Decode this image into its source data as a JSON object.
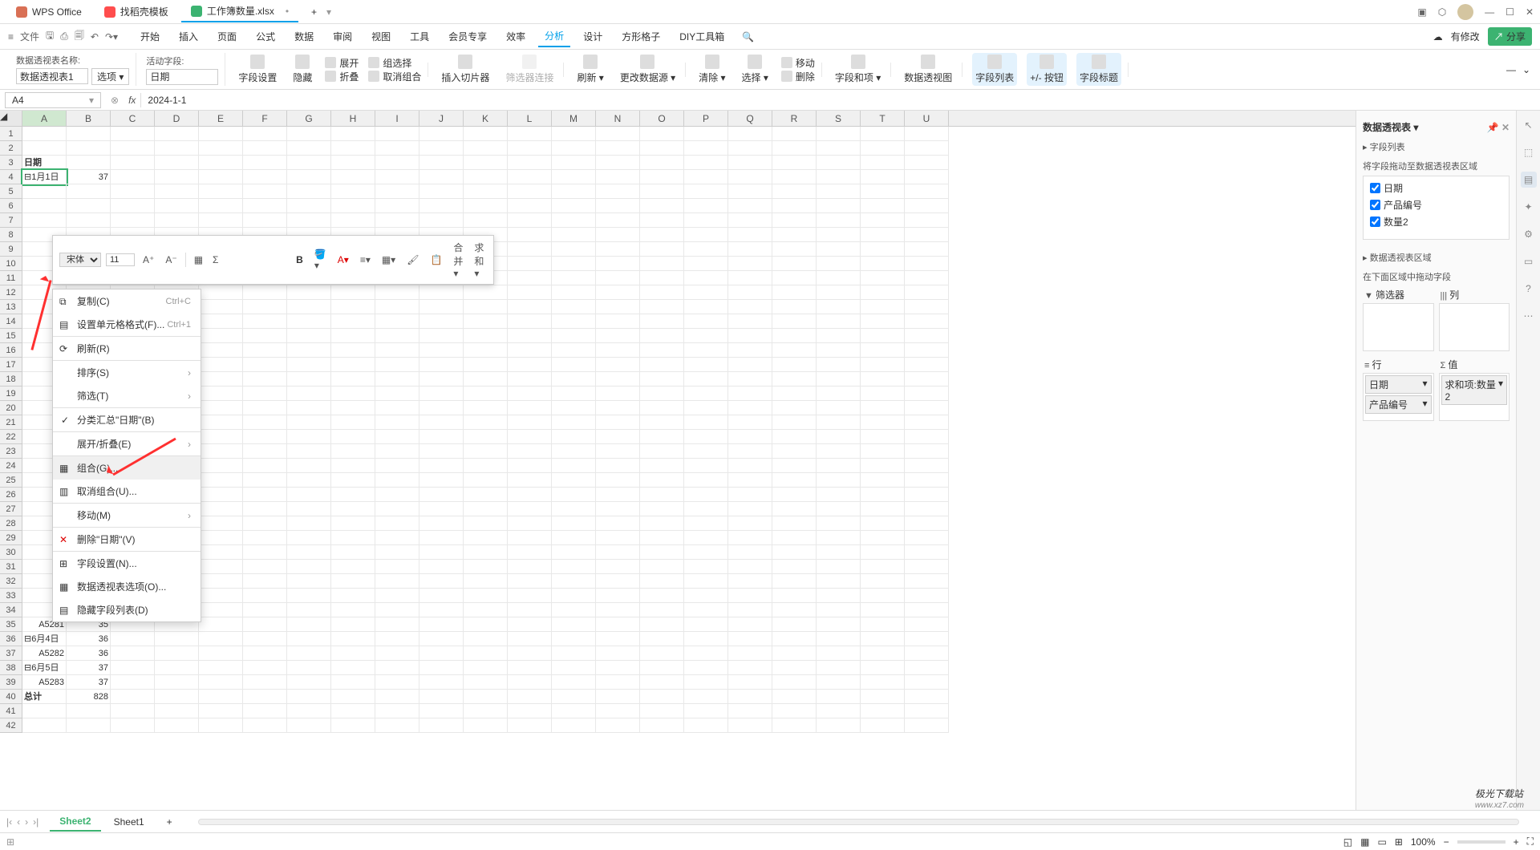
{
  "titlebar": {
    "tabs": [
      {
        "label": "WPS Office",
        "icon": "w"
      },
      {
        "label": "找稻壳模板",
        "icon": "d"
      },
      {
        "label": "工作簿数量.xlsx",
        "icon": "s",
        "active": true,
        "dirty": "•"
      }
    ],
    "add": "+"
  },
  "menubar": {
    "file": "文件",
    "items": [
      "开始",
      "插入",
      "页面",
      "公式",
      "数据",
      "审阅",
      "视图",
      "工具",
      "会员专享",
      "效率",
      "分析",
      "设计",
      "方形格子",
      "DIY工具箱"
    ],
    "active": "分析",
    "pending": "有修改",
    "share": "分享"
  },
  "ribbon": {
    "nameLabel": "数据透视表名称:",
    "nameVal": "数据透视表1",
    "optBtn": "选项 ▾",
    "activeLabel": "活动字段:",
    "activeVal": "日期",
    "fieldSet": "字段设置",
    "hide": "隐藏",
    "expand": "展开",
    "collapse": "折叠",
    "groupSel": "组选择",
    "ungroup": "取消组合",
    "slicer": "插入切片器",
    "conn": "筛选器连接",
    "refresh": "刷新 ▾",
    "changeSrc": "更改数据源 ▾",
    "clear": "清除 ▾",
    "select": "选择 ▾",
    "move": "移动",
    "delete": "删除",
    "fieldItem": "字段和项 ▾",
    "chart": "数据透视图",
    "fieldList": "字段列表",
    "pmBtn": "+/- 按钮",
    "fieldHdr": "字段标题"
  },
  "formula": {
    "cell": "A4",
    "value": "2024-1-1"
  },
  "columns": [
    "A",
    "B",
    "C",
    "D",
    "E",
    "F",
    "G",
    "H",
    "I",
    "J",
    "K",
    "L",
    "M",
    "N",
    "O",
    "P",
    "Q",
    "R",
    "S",
    "T",
    "U"
  ],
  "mini": {
    "font": "宋体",
    "size": "11",
    "merge": "合并 ▾",
    "sum": "求和 ▾"
  },
  "context": {
    "copy": "复制(C)",
    "copy_s": "Ctrl+C",
    "format": "设置单元格格式(F)...",
    "format_s": "Ctrl+1",
    "refresh": "刷新(R)",
    "sort": "排序(S)",
    "filter": "筛选(T)",
    "subtotal": "分类汇总\"日期\"(B)",
    "expand": "展开/折叠(E)",
    "group": "组合(G)...",
    "ungroup": "取消组合(U)...",
    "move": "移动(M)",
    "delete": "删除\"日期\"(V)",
    "fieldset": "字段设置(N)...",
    "pivotopt": "数据透视表选项(O)...",
    "hidefield": "隐藏字段列表(D)"
  },
  "cells": {
    "a3": "日期",
    "a4": "⊟1月1日",
    "b4": "37",
    "a35": "A5281",
    "b35": "35",
    "a36": "⊟6月4日",
    "b36": "36",
    "a37": "A5282",
    "b37": "36",
    "a38": "⊟6月5日",
    "b38": "37",
    "a39": "A5283",
    "b39": "37",
    "a40": "总计",
    "b40": "828"
  },
  "side": {
    "title": "数据透视表 ▾",
    "fieldsTitle": "▸ 字段列表",
    "dragHint": "将字段拖动至数据透视表区域",
    "fields": [
      "日期",
      "产品编号",
      "数量2"
    ],
    "areaTitle": "▸ 数据透视表区域",
    "areaHint": "在下面区域中拖动字段",
    "filterLbl": "筛选器",
    "colLbl": "列",
    "rowLbl": "行",
    "valLbl": "值",
    "rowItems": [
      "日期",
      "产品编号"
    ],
    "valItems": [
      "求和项:数量2"
    ]
  },
  "sheets": {
    "s1": "Sheet2",
    "s2": "Sheet1",
    "add": "+"
  },
  "status": {
    "zoom": "100%"
  },
  "watermark": {
    "t": "极光下载站",
    "u": "www.xz7.com"
  }
}
